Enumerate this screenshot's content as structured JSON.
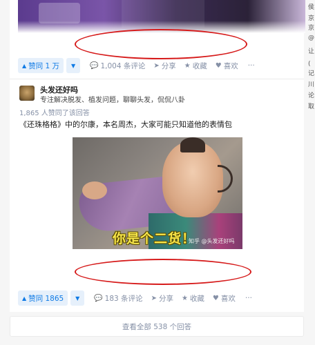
{
  "answer1": {
    "vote_up_label": "赞同 1 万",
    "comments_label": "1,004 条评论",
    "share_label": "分享",
    "favorite_label": "收藏",
    "like_label": "喜欢",
    "more_label": "···"
  },
  "answer2": {
    "author_name": "头发还好吗",
    "author_bio": "专注解决脱发、植发问题，聊聊头发，侃侃八卦",
    "upvote_info": "1,865 人赞同了该回答",
    "body_text": "《还珠格格》中的尔康，本名周杰，大家可能只知道他的表情包",
    "meme_caption": "你是个二货！",
    "meme_watermark": "知乎 @头发还好吗",
    "vote_up_label": "赞同 1865",
    "comments_label": "183 条评论",
    "share_label": "分享",
    "favorite_label": "收藏",
    "like_label": "喜欢",
    "more_label": "···"
  },
  "view_all_label": "查看全部 538 个回答",
  "right_strip": [
    "侯",
    "京",
    "京",
    "@",
    "让",
    "(",
    "记",
    "川",
    "论",
    "取"
  ],
  "icons": {
    "vote_up": "▲",
    "vote_down": "▼",
    "comment": "comment-icon",
    "share": "share-icon",
    "favorite": "star-icon",
    "like": "heart-icon"
  },
  "colors": {
    "accent": "#0f7ae5",
    "annotation_red": "#d61a1a",
    "muted": "#8590a6"
  }
}
